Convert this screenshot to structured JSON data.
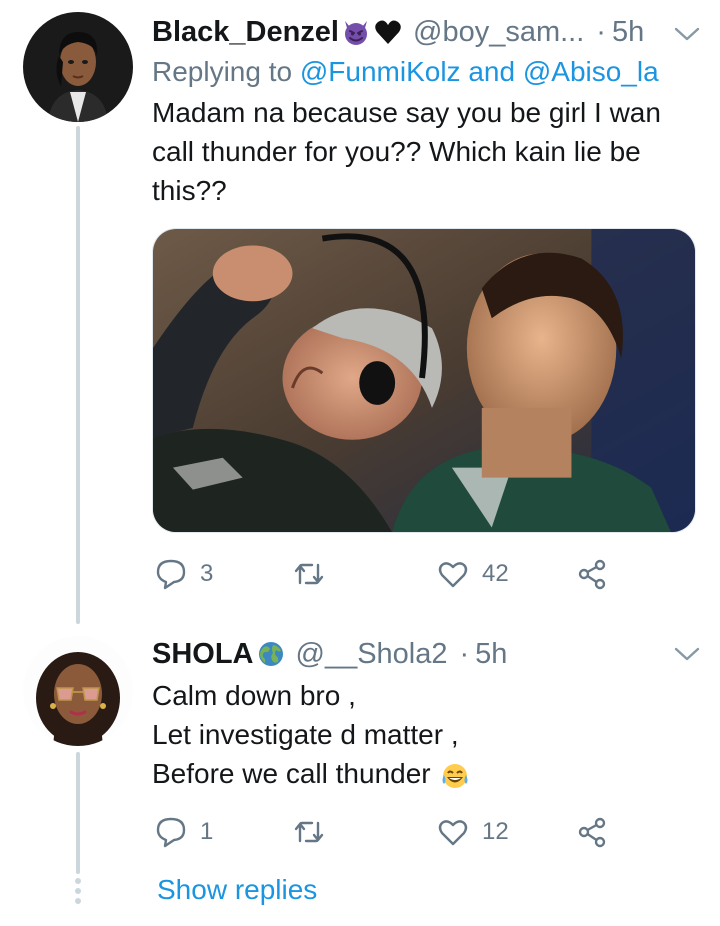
{
  "tweets": [
    {
      "name": "Black_Denzel",
      "handle": "@boy_sam...",
      "separator": "·",
      "time": "5h",
      "name_emojis": [
        "smiling-devil-emoji",
        "black-heart-emoji"
      ],
      "replying_prefix": "Replying to",
      "replying_user1": "@FunmiKolz",
      "replying_and": "and",
      "replying_user2": "@Abiso_la",
      "text_lines": [
        "Madam na because say you be girl I wan",
        "call thunder for you?? Which kain lie be",
        "this??"
      ],
      "media": "photo-man-with-headset-and-young-man",
      "reply_count": "3",
      "retweet_count": "",
      "like_count": "42"
    },
    {
      "name": "SHOLA",
      "handle": "@__Shola2",
      "separator": "·",
      "time": "5h",
      "name_emojis": [
        "globe-emoji"
      ],
      "text_lines": [
        "Calm down bro ,",
        "Let investigate d matter ,",
        "Before we call thunder"
      ],
      "text_emoji": "tears-of-joy-emoji",
      "reply_count": "1",
      "retweet_count": "",
      "like_count": "12"
    }
  ],
  "show_replies": "Show replies",
  "colors": {
    "accent": "#1b95e0",
    "secondary_text": "#657786",
    "primary_text": "#14171a",
    "thread_line": "#ccd6dd"
  },
  "icons": {
    "reply": "speech-bubble-icon",
    "retweet": "retweet-arrows-icon",
    "like": "heart-outline-icon",
    "share": "share-nodes-icon",
    "caret": "chevron-down-icon"
  }
}
